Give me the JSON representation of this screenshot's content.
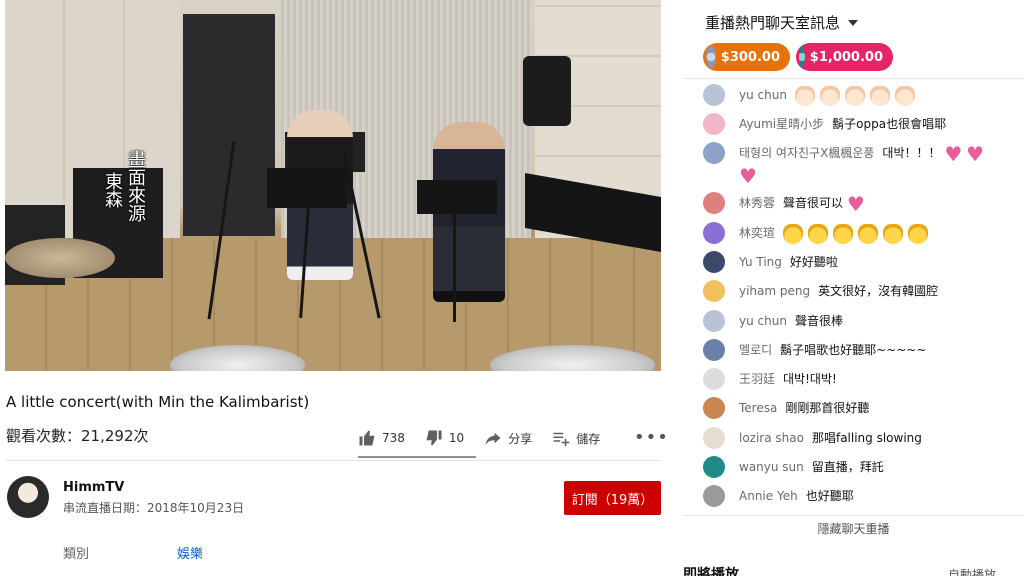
{
  "video": {
    "watermark_lines": [
      "畫面來源",
      "東森"
    ]
  },
  "video_info": {
    "title": "A little concert(with Min the Kalimbarist)",
    "views": "觀看次數：21,292次",
    "like_count": "738",
    "dislike_count": "10",
    "share_label": "分享",
    "save_label": "儲存",
    "more_label": "•••"
  },
  "channel": {
    "name": "HimmTV",
    "published": "串流直播日期：2018年10月23日",
    "subscribe_label": "訂閱（19萬）",
    "category_label": "類別",
    "category_value": "娛樂"
  },
  "chat": {
    "header": "重播熱門聊天室訊息",
    "superchats": [
      {
        "amount": "$300.00"
      },
      {
        "amount": "$1,000.00"
      }
    ],
    "messages": [
      {
        "author": "yu chun",
        "text": "",
        "emoji": "clap-light",
        "emoji_count": 5,
        "avatar_color": "#b9c3d6"
      },
      {
        "author": "Ayumi星晴小步",
        "text": "鬍子oppa也很會唱耶",
        "avatar_color": "#f1b6c8"
      },
      {
        "author": "태형의 여자친구X楓楓운풍",
        "text": "대박！！！",
        "hearts": 3,
        "avatar_color": "#8da2c9"
      },
      {
        "author": "林秀蓉",
        "text": "聲音很可以",
        "hearts": 1,
        "avatar_color": "#e07f7f"
      },
      {
        "author": "林奕瑄",
        "text": "",
        "emoji": "clap-yellow",
        "emoji_count": 6,
        "avatar_color": "#8a6fd6"
      },
      {
        "author": "Yu Ting",
        "text": "好好聽啦",
        "avatar_color": "#3b4a6b"
      },
      {
        "author": "yiham peng",
        "text": "英文很好，沒有韓國腔",
        "avatar_color": "#f0c05a"
      },
      {
        "author": "yu chun",
        "text": "聲音很棒",
        "avatar_color": "#b9c3d6"
      },
      {
        "author": "멜로디",
        "text": "鬍子唱歌也好聽耶~~~~~",
        "avatar_color": "#6b7fa8"
      },
      {
        "author": "王羽廷",
        "text": "대박!대박!",
        "avatar_color": "#dddddd"
      },
      {
        "author": "Teresa",
        "text": "剛剛那首很好聽",
        "avatar_color": "#c9864f"
      },
      {
        "author": "lozira shao",
        "text": "那唱falling slowing",
        "avatar_color": "#e6ddd2"
      },
      {
        "author": "wanyu sun",
        "text": "留直播，拜託",
        "avatar_color": "#1f8a86"
      },
      {
        "author": "Annie Yeh",
        "text": "也好聽耶",
        "avatar_color": "#9a9a9a"
      }
    ],
    "hide_label": "隱藏聊天重播"
  },
  "sidebar": {
    "up_next": "即將播放",
    "autoplay": "自動播放"
  },
  "colors": {
    "subscribe": "#cc0000",
    "superchat_orange": "#e8710a",
    "superchat_pink": "#e52467",
    "link_blue": "#065fd4"
  }
}
